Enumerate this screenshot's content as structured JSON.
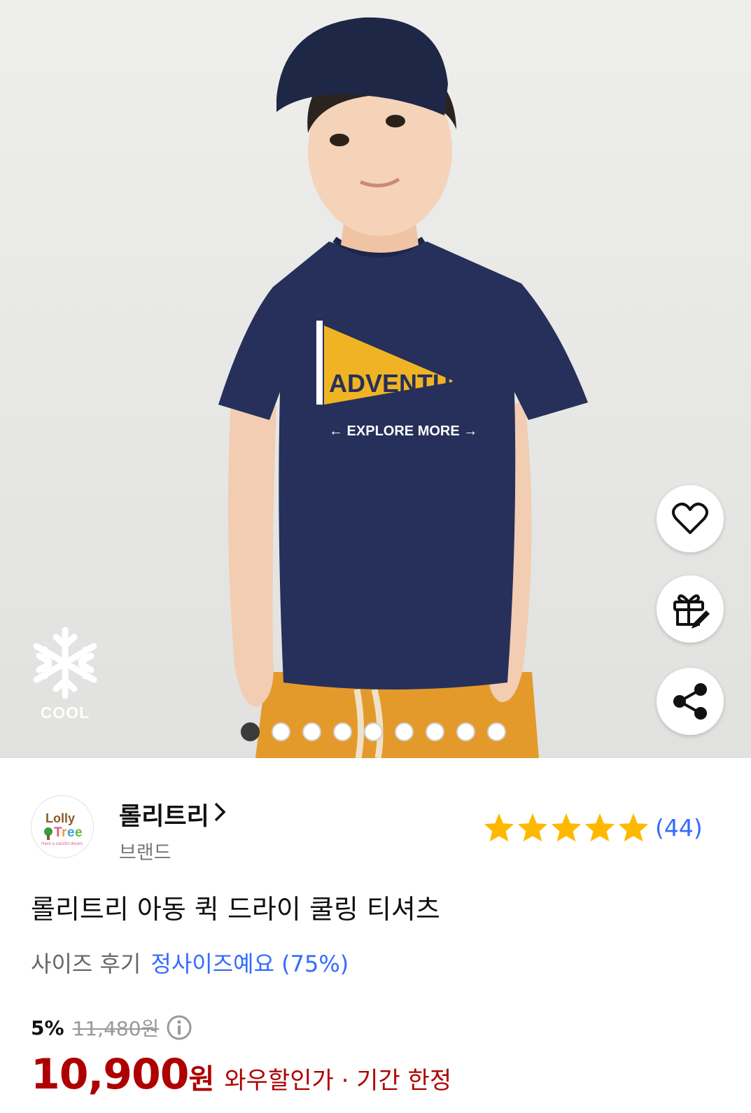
{
  "hero": {
    "badge_label": "COOL",
    "shirt_print": {
      "title_big": "AD",
      "title_small": "VENTURE",
      "subtitle": "EXPLORE MORE"
    },
    "actions": [
      "heart-icon",
      "gift-icon",
      "share-icon"
    ],
    "carousel": {
      "total": 9,
      "active_index": 0
    }
  },
  "brand": {
    "name": "롤리트리",
    "chevron": "〉",
    "subtitle": "브랜드",
    "logo_text_1": "Lolly",
    "logo_text_2": "Tree",
    "logo_tagline": "Have a colorful dream"
  },
  "rating": {
    "stars": 5,
    "count": "(44)",
    "star_color": "#ffb800"
  },
  "product": {
    "title": "롤리트리 아동 퀵 드라이 쿨링 티셔츠",
    "size_review_label": "사이즈 후기",
    "size_review_value": "정사이즈예요 (75%)"
  },
  "price": {
    "discount": "5%",
    "original": "11,480원",
    "sale": "10,900",
    "won": "원",
    "note": "와우할인가 · 기간 한정"
  },
  "colors": {
    "accent_blue": "#346aff",
    "price_red": "#ae0000",
    "navy": "#26305a",
    "mustard": "#f0b323"
  }
}
